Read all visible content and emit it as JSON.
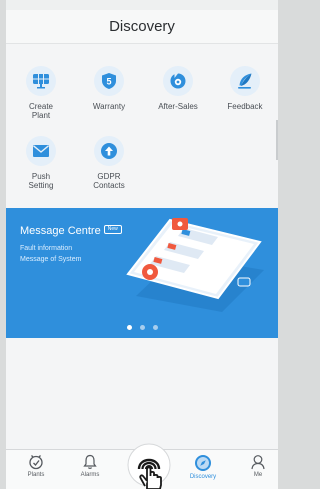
{
  "header": {
    "title": "Discovery"
  },
  "tools": [
    {
      "label": "Create\nPlant",
      "icon": "plant-monitor-icon"
    },
    {
      "label": "Warranty",
      "icon": "warranty-shield-icon"
    },
    {
      "label": "After-Sales",
      "icon": "after-sales-icon"
    },
    {
      "label": "Feedback",
      "icon": "feedback-leaf-icon"
    },
    {
      "label": "Push\nSetting",
      "icon": "envelope-icon"
    },
    {
      "label": "GDPR\nContacts",
      "icon": "upload-arrow-icon"
    }
  ],
  "banner": {
    "title": "Message Centre",
    "badge": "New",
    "line1": "Fault information",
    "line2": "Message of System",
    "pages": 3,
    "active_page": 0
  },
  "tabbar": {
    "items": [
      {
        "label": "Plants",
        "icon": "plants-icon",
        "active": false
      },
      {
        "label": "Alarms",
        "icon": "bell-icon",
        "active": false
      },
      {
        "label": "Discovery",
        "icon": "compass-icon",
        "active": true
      },
      {
        "label": "Me",
        "icon": "person-icon",
        "active": false
      }
    ]
  },
  "colors": {
    "accent": "#2f8fdc",
    "icon_bg": "#e4eff9",
    "alert_red": "#f0593e"
  }
}
